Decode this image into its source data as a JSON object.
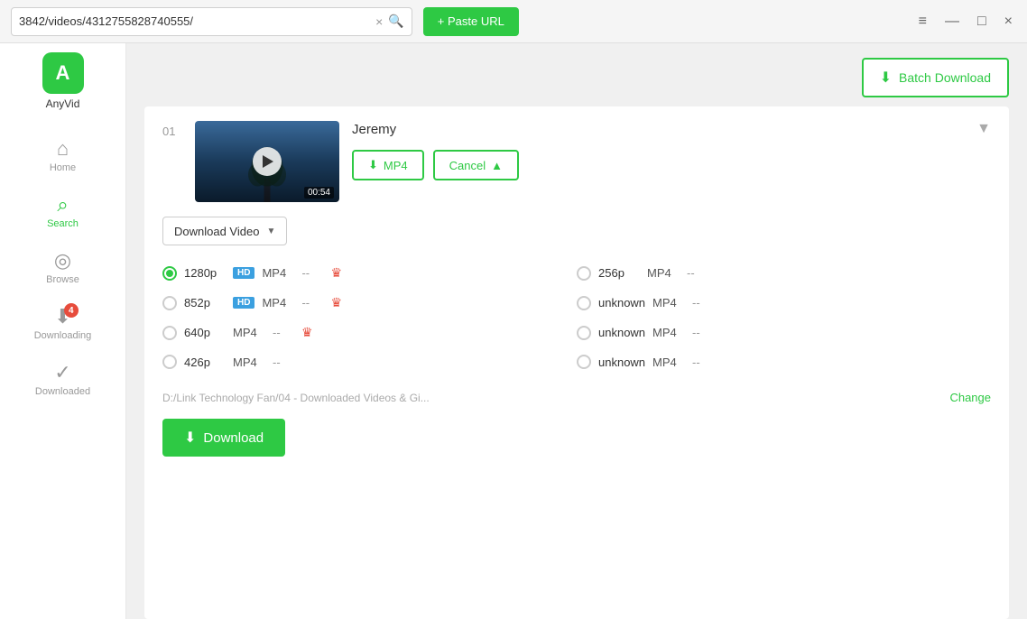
{
  "titleBar": {
    "urlValue": "3842/videos/4312755828740555/",
    "clearBtn": "×",
    "pasteUrlBtn": "+ Paste URL",
    "windowControls": {
      "menu": "≡",
      "minimize": "—",
      "maximize": "□",
      "close": "×"
    }
  },
  "sidebar": {
    "logo": {
      "iconText": "A",
      "label": "AnyVid"
    },
    "items": [
      {
        "id": "home",
        "icon": "⌂",
        "label": "Home",
        "active": false,
        "badge": null
      },
      {
        "id": "search",
        "icon": "⌕",
        "label": "Search",
        "active": true,
        "badge": null
      },
      {
        "id": "browse",
        "icon": "⊙",
        "label": "Browse",
        "active": false,
        "badge": null
      },
      {
        "id": "downloading",
        "icon": "⬇",
        "label": "Downloading",
        "active": false,
        "badge": "4"
      },
      {
        "id": "downloaded",
        "icon": "✓",
        "label": "Downloaded",
        "active": false,
        "badge": null
      }
    ]
  },
  "content": {
    "batchDownloadBtn": "Batch Download",
    "videoCard": {
      "number": "01",
      "title": "Jeremy",
      "duration": "00:54",
      "mp4Btn": "MP4",
      "cancelBtn": "Cancel",
      "downloadVideoLabel": "Download Video",
      "qualities": [
        {
          "id": "q1280",
          "label": "1280p",
          "hd": true,
          "format": "MP4",
          "size": "--",
          "premium": true,
          "selected": true,
          "col": 1
        },
        {
          "id": "q256",
          "label": "256p",
          "hd": false,
          "format": "MP4",
          "size": "--",
          "premium": false,
          "selected": false,
          "col": 2
        },
        {
          "id": "q852",
          "label": "852p",
          "hd": true,
          "format": "MP4",
          "size": "--",
          "premium": true,
          "selected": false,
          "col": 1
        },
        {
          "id": "qunk1",
          "label": "unknown",
          "hd": false,
          "format": "MP4",
          "size": "--",
          "premium": false,
          "selected": false,
          "col": 2
        },
        {
          "id": "q640",
          "label": "640p",
          "hd": false,
          "format": "MP4",
          "size": "--",
          "premium": true,
          "selected": false,
          "col": 1
        },
        {
          "id": "qunk2",
          "label": "unknown",
          "hd": false,
          "format": "MP4",
          "size": "--",
          "premium": false,
          "selected": false,
          "col": 2
        },
        {
          "id": "q426",
          "label": "426p",
          "hd": false,
          "format": "MP4",
          "size": "--",
          "premium": false,
          "selected": false,
          "col": 1
        },
        {
          "id": "qunk3",
          "label": "unknown",
          "hd": false,
          "format": "MP4",
          "size": "--",
          "premium": false,
          "selected": false,
          "col": 2
        }
      ],
      "savePath": "D:/Link Technology Fan/04 - Downloaded Videos & Gi...",
      "changeBtn": "Change",
      "downloadBtn": "Download"
    }
  }
}
